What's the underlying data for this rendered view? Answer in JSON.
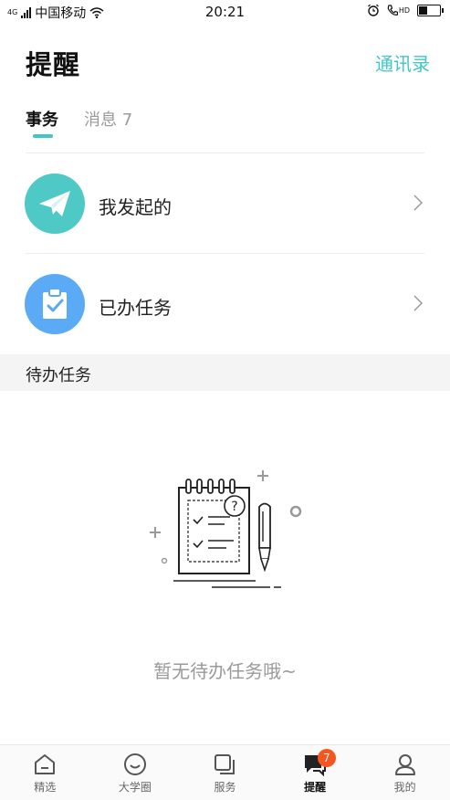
{
  "status_bar": {
    "network": "4G",
    "carrier": "中国移动",
    "time": "20:21",
    "call_label": "HD"
  },
  "header": {
    "title": "提醒",
    "contacts_link": "通讯录"
  },
  "tabs": [
    {
      "label": "事务",
      "active": true
    },
    {
      "label": "消息 7",
      "active": false
    }
  ],
  "rows": [
    {
      "label": "我发起的",
      "icon": "paper-plane-icon",
      "icon_bg": "#4ec9c6"
    },
    {
      "label": "已办任务",
      "icon": "clipboard-check-icon",
      "icon_bg": "#5aaaf5"
    }
  ],
  "section": {
    "title": "待办任务"
  },
  "empty_state": {
    "illustration": "notebook-and-pen-icon",
    "text": "暂无待办任务哦~"
  },
  "bottom_nav": [
    {
      "label": "精选",
      "icon": "home-icon"
    },
    {
      "label": "大学圈",
      "icon": "smile-icon"
    },
    {
      "label": "服务",
      "icon": "layers-icon"
    },
    {
      "label": "提醒",
      "icon": "chat-bubble-icon",
      "active": true,
      "badge": "7"
    },
    {
      "label": "我的",
      "icon": "user-icon"
    }
  ],
  "colors": {
    "accent": "#3fc7c6",
    "badge": "#f5561f",
    "muted_text": "#9a9a9a"
  }
}
